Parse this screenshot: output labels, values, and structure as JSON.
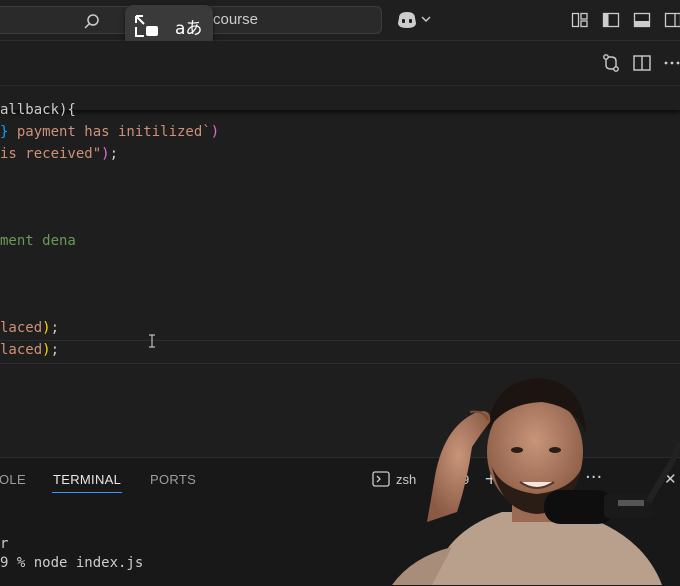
{
  "titlebar": {
    "search_text": "course",
    "overlay_buttons": [
      "exit-picture-in-picture-icon",
      "translate-icon"
    ],
    "translate_glyph": "aあ"
  },
  "editor": {
    "lines": [
      {
        "segments": [
          {
            "text": "allback){",
            "cls": "t-pun"
          }
        ]
      },
      {
        "segments": [
          {
            "text": "} ",
            "cls": "t-brk3"
          },
          {
            "text": "payment has initilized`",
            "cls": "t-str"
          },
          {
            "text": ")",
            "cls": "t-brk2"
          }
        ]
      },
      {
        "segments": [
          {
            "text": "is received\"",
            "cls": "t-str"
          },
          {
            "text": ")",
            "cls": "t-brk2"
          },
          {
            "text": ";",
            "cls": "t-pun"
          }
        ]
      },
      {
        "segments": [
          {
            "text": "ment dena",
            "cls": "t-cmt"
          }
        ]
      },
      {
        "segments": [
          {
            "text": "laced",
            "cls": "t-str"
          },
          {
            "text": ")",
            "cls": "t-brk1"
          },
          {
            "text": ";",
            "cls": "t-pun"
          }
        ]
      },
      {
        "segments": [
          {
            "text": "laced",
            "cls": "t-str"
          },
          {
            "text": ")",
            "cls": "t-brk1"
          },
          {
            "text": ";",
            "cls": "t-pun"
          }
        ]
      }
    ]
  },
  "panel": {
    "tabs": [
      {
        "label": "OLE",
        "active": false
      },
      {
        "label": "TERMINAL",
        "active": true
      },
      {
        "label": "PORTS",
        "active": false
      }
    ],
    "terminal_shell": "zsh",
    "terminal_extra": "9",
    "more_label": "···",
    "close_label": "✕",
    "plus_label": "+",
    "terminal_lines": [
      "r",
      "9 % node index.js"
    ]
  },
  "colors": {
    "accent": "#3794ff",
    "editor_bg": "#1e1e1e",
    "panel_bg": "#181818"
  }
}
